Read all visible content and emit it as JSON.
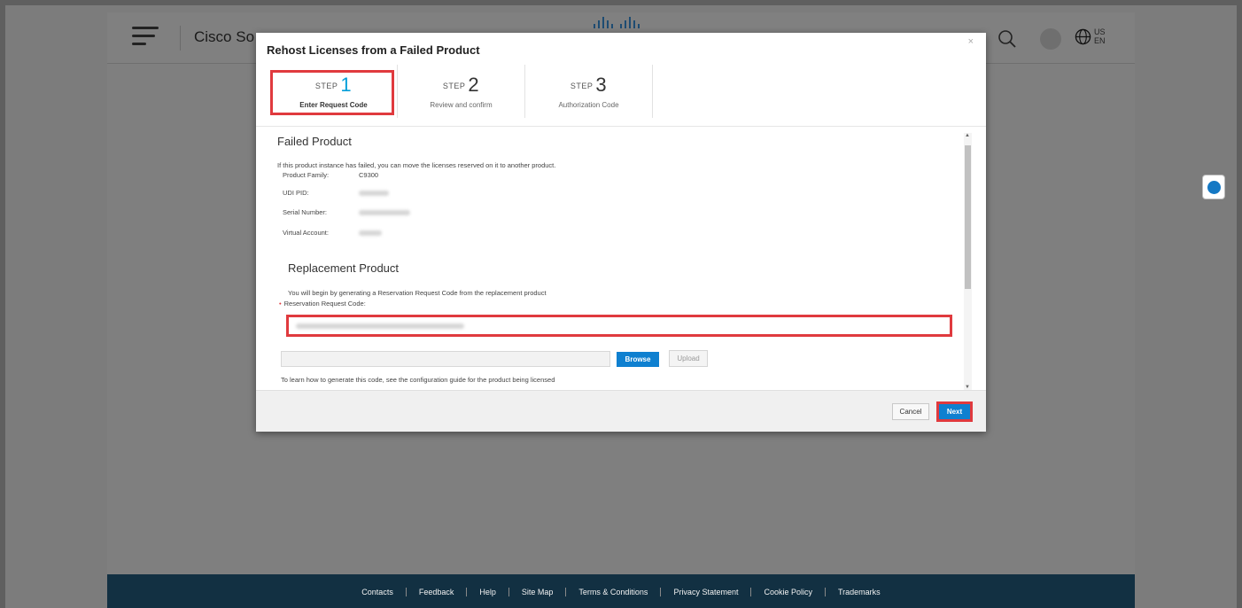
{
  "header": {
    "brand": "Cisco So",
    "lang_top": "US",
    "lang_bottom": "EN"
  },
  "modal": {
    "title": "Rehost Licenses from a Failed Product",
    "close_glyph": "×",
    "steps": [
      {
        "prefix": "STEP",
        "number": "1",
        "label": "Enter Request Code"
      },
      {
        "prefix": "STEP",
        "number": "2",
        "label": "Review and confirm"
      },
      {
        "prefix": "STEP",
        "number": "3",
        "label": "Authorization Code"
      }
    ],
    "failed_product": {
      "title": "Failed Product",
      "description": "If this product instance has failed, you can move the licenses reserved on it to another product.",
      "fields": [
        {
          "label": "Product Family:",
          "value": "C9300"
        },
        {
          "label": "UDI PID:",
          "value": ""
        },
        {
          "label": "Serial Number:",
          "value": ""
        },
        {
          "label": "Virtual Account:",
          "value": ""
        }
      ]
    },
    "replacement_product": {
      "title": "Replacement Product",
      "description": "You will begin by generating a Reservation Request Code from the replacement product",
      "code_label": "Reservation Request Code:",
      "browse_label": "Browse",
      "upload_label": "Upload",
      "help_text": "To learn how to generate this code, see the configuration guide for the product being licensed"
    },
    "cancel_label": "Cancel",
    "next_label": "Next"
  },
  "footer": {
    "links": [
      "Contacts",
      "Feedback",
      "Help",
      "Site Map",
      "Terms & Conditions",
      "Privacy Statement",
      "Cookie Policy",
      "Trademarks"
    ]
  },
  "colors": {
    "accent": "#049fd9",
    "primary_button": "#0f80d0",
    "highlight": "#e03a3e",
    "footer_bg": "#123042"
  },
  "icons": [
    "menu-icon",
    "cisco-logo",
    "search-icon",
    "globe-icon",
    "close-icon",
    "chat-icon"
  ]
}
